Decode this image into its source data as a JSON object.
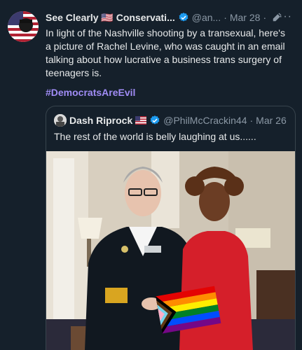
{
  "tweet": {
    "author_name": "See Clearly 🇺🇸 Conservati...",
    "author_handle": "@an...",
    "separator": "·",
    "date": "Mar 28",
    "more_label": "···",
    "body": "In light of the Nashville shooting by a transexual, here's a picture of Rachel Levine, who was caught in an email talking about how lucrative a business trans surgery of teenagers is.",
    "hashtag": "#DemocratsAreEvil"
  },
  "quote": {
    "author_name": "Dash Riprock",
    "author_handle": "@PhilMcCrackin44",
    "separator": "·",
    "date": "Mar 26",
    "text": "The rest of the world is belly laughing at us......"
  },
  "colors": {
    "background": "#15202b",
    "verified": "#1d9bf0",
    "hashtag": "#a08cf5",
    "border": "#38444d",
    "secondary_text": "#8b98a5"
  },
  "icons": [
    "us-flag-icon",
    "verified-badge-icon",
    "edit-pencil-icon",
    "more-options-icon"
  ]
}
